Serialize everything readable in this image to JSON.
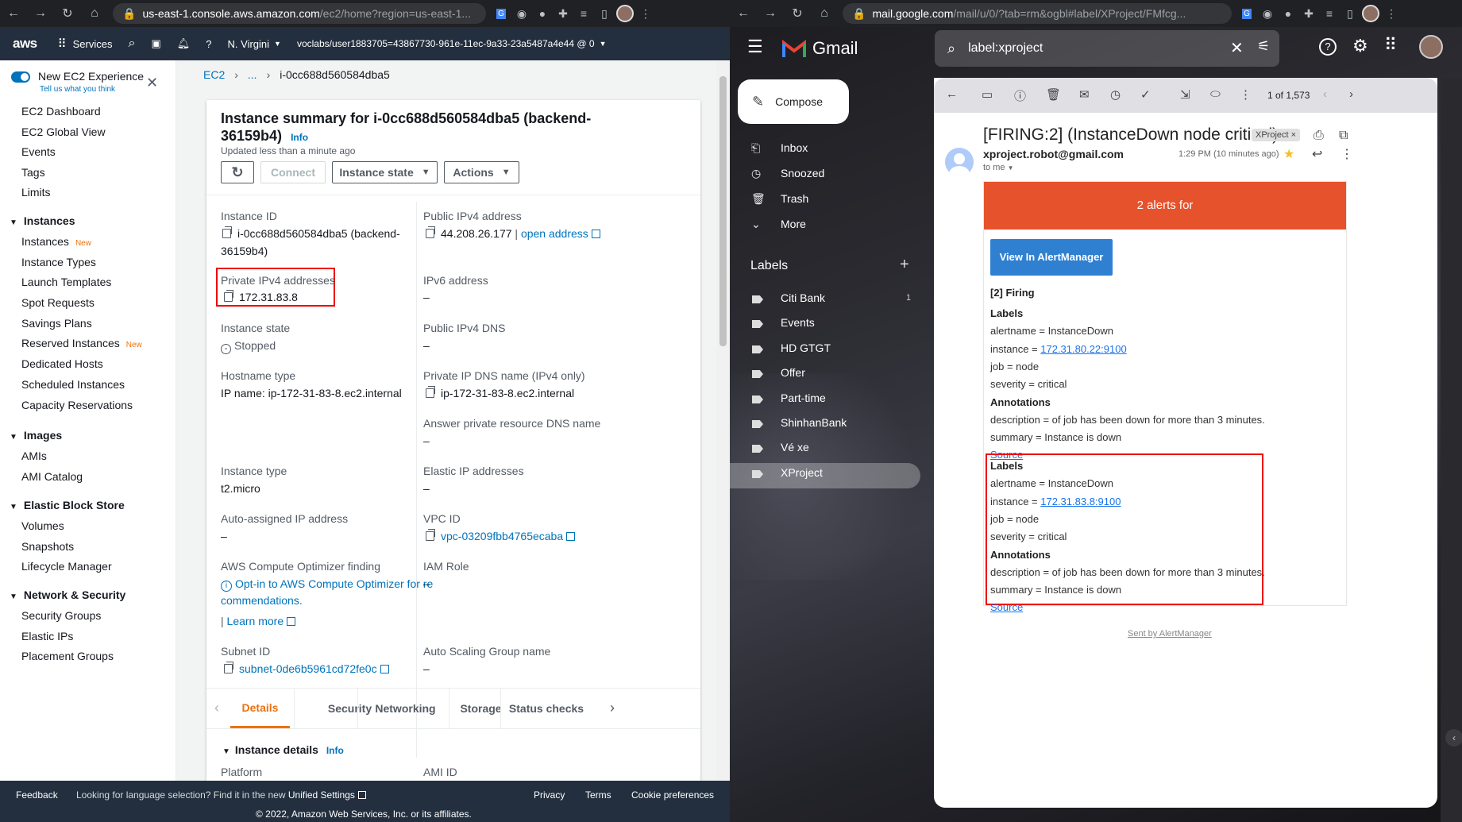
{
  "left_browser": {
    "url_host": "us-east-1.console.aws.amazon.com",
    "url_rest": "/ec2/home?region=us-east-1..."
  },
  "aws_nav": {
    "logo": "aws",
    "services": "Services",
    "region": "N. Virgini",
    "account": "voclabs/user1883705=43867730-961e-11ec-9a33-23a5487a4e44 @ 0"
  },
  "sidebar": {
    "toggle_label": "New EC2 Experience",
    "toggle_sub": "Tell us what you think",
    "top_items": [
      "EC2 Dashboard",
      "EC2 Global View",
      "Events",
      "Tags",
      "Limits"
    ],
    "sections": [
      {
        "title": "Instances",
        "items": [
          {
            "label": "Instances",
            "badge": "New"
          },
          {
            "label": "Instance Types"
          },
          {
            "label": "Launch Templates"
          },
          {
            "label": "Spot Requests"
          },
          {
            "label": "Savings Plans"
          },
          {
            "label": "Reserved Instances",
            "badge": "New"
          },
          {
            "label": "Dedicated Hosts"
          },
          {
            "label": "Scheduled Instances"
          },
          {
            "label": "Capacity Reservations"
          }
        ]
      },
      {
        "title": "Images",
        "items": [
          {
            "label": "AMIs"
          },
          {
            "label": "AMI Catalog"
          }
        ]
      },
      {
        "title": "Elastic Block Store",
        "items": [
          {
            "label": "Volumes"
          },
          {
            "label": "Snapshots"
          },
          {
            "label": "Lifecycle Manager"
          }
        ]
      },
      {
        "title": "Network & Security",
        "items": [
          {
            "label": "Security Groups"
          },
          {
            "label": "Elastic IPs"
          },
          {
            "label": "Placement Groups"
          }
        ]
      }
    ]
  },
  "breadcrumb": {
    "root": "EC2",
    "ellipsis": "...",
    "current": "i-0cc688d560584dba5"
  },
  "summary": {
    "title_line1": "Instance summary for i-0cc688d560584dba5 (backend-",
    "title_line2": "36159b4)",
    "info": "Info",
    "updated": "Updated less than a minute ago",
    "connect": "Connect",
    "instance_state_btn": "Instance state",
    "actions_btn": "Actions",
    "instance_id_label": "Instance ID",
    "instance_id_1": "i-0cc688d560584dba5 (backend-",
    "instance_id_2": "36159b4)",
    "public_ipv4_label": "Public IPv4 address",
    "public_ipv4": "44.208.26.177",
    "open_address": "open address",
    "private_ipv4_label": "Private IPv4 addresses",
    "private_ipv4": "172.31.83.8",
    "ipv6_label": "IPv6 address",
    "ipv6": "–",
    "state_label": "Instance state",
    "state": "Stopped",
    "public_dns_label": "Public IPv4 DNS",
    "public_dns": "–",
    "hostname_type_label": "Hostname type",
    "hostname_type": "IP name: ip-172-31-83-8.ec2.internal",
    "private_dns_label": "Private IP DNS name (IPv4 only)",
    "private_dns": "ip-172-31-83-8.ec2.internal",
    "answer_dns_label": "Answer private resource DNS name",
    "answer_dns": "–",
    "type_label": "Instance type",
    "type": "t2.micro",
    "eip_label": "Elastic IP addresses",
    "eip": "–",
    "auto_ip_label": "Auto-assigned IP address",
    "auto_ip": "–",
    "vpc_label": "VPC ID",
    "vpc": "vpc-03209fbb4765ecaba",
    "optimizer_label": "AWS Compute Optimizer finding",
    "optimizer_1": "Opt-in to AWS Compute Optimizer for re",
    "optimizer_2": "commendations.",
    "learn_more": "Learn more",
    "iam_label": "IAM Role",
    "iam": "–",
    "subnet_label": "Subnet ID",
    "subnet": "subnet-0de6b5961cd72fe0c",
    "asg_label": "Auto Scaling Group name",
    "asg": "–"
  },
  "tabs": [
    "Details",
    "Security",
    "Networking",
    "Storage",
    "Status checks"
  ],
  "details": {
    "title": "Instance details",
    "info": "Info",
    "platform": "Platform",
    "ami": "AMI ID"
  },
  "aws_footer": {
    "feedback": "Feedback",
    "lang": "Looking for language selection? Find it in the new",
    "unified": "Unified Settings",
    "privacy": "Privacy",
    "terms": "Terms",
    "cookie": "Cookie preferences",
    "copyright": "© 2022, Amazon Web Services, Inc. or its affiliates."
  },
  "right_browser": {
    "url_host": "mail.google.com",
    "url_rest": "/mail/u/0/?tab=rm&ogbl#label/XProject/FMfcg..."
  },
  "gmail": {
    "logo": "Gmail",
    "search": "label:xproject",
    "compose": "Compose",
    "nav": [
      "Inbox",
      "Snoozed",
      "Trash",
      "More"
    ],
    "labels_title": "Labels",
    "labels": [
      {
        "name": "Citi Bank",
        "count": "1"
      },
      {
        "name": "Events"
      },
      {
        "name": "HD GTGT"
      },
      {
        "name": "Offer"
      },
      {
        "name": "Part-time"
      },
      {
        "name": "ShinhanBank"
      },
      {
        "name": "Vé xe"
      },
      {
        "name": "XProject"
      }
    ],
    "pager": "1 of 1,573",
    "subject": "[FIRING:2] (InstanceDown node critical)",
    "tag": "XProject",
    "sender": "xproject.robot@gmail.com",
    "time": "1:29 PM (10 minutes ago)",
    "to": "to me",
    "banner": "2 alerts for",
    "view_btn": "View In AlertManager",
    "firing": "[2] Firing",
    "alert1": {
      "labels": "Labels",
      "alertname": "alertname = InstanceDown",
      "instance_pre": "instance = ",
      "instance": "172.31.80.22:9100",
      "job": "job = node",
      "severity": "severity = critical",
      "annotations": "Annotations",
      "description": "description = of job has been down for more than 3 minutes.",
      "summary": "summary = Instance is down",
      "source": "Source"
    },
    "alert2": {
      "labels": "Labels",
      "alertname": "alertname = InstanceDown",
      "instance_pre": "instance = ",
      "instance": "172.31.83.8:9100",
      "job": "job = node",
      "severity": "severity = critical",
      "annotations": "Annotations",
      "description": "description = of job has been down for more than 3 minutes.",
      "summary": "summary = Instance is down",
      "source": "Source"
    },
    "sent_by": "Sent by AlertManager"
  }
}
